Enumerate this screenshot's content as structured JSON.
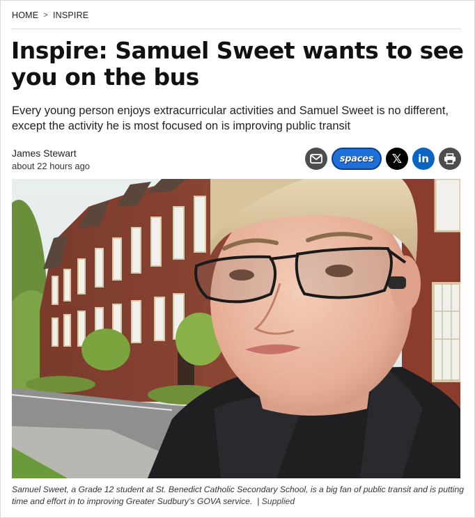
{
  "breadcrumb": {
    "home": "HOME",
    "separator": ">",
    "section": "INSPIRE"
  },
  "article": {
    "headline": "Inspire: Samuel Sweet wants to see you on the bus",
    "dek": "Every young person enjoys extracurricular activities and Samuel Sweet is no different, except the activity he is most focused on is improving public transit",
    "author": "James Stewart",
    "timestamp": "about 22 hours ago"
  },
  "share": {
    "email_icon": "envelope-icon",
    "spaces_label": "spaces",
    "x_label": "𝕏",
    "linkedin_label": "in",
    "print_icon": "printer-icon"
  },
  "photo": {
    "caption": "Samuel Sweet, a Grade 12 student at St. Benedict Catholic Secondary School, is a big fan of public transit and is putting time and effort in to improving Greater Sudbury's GOVA service.",
    "credit_separator": "|",
    "credit": "Supplied"
  },
  "colors": {
    "linkedin": "#0a66c2",
    "spaces": "#1e6fd9",
    "icon_dark": "#4d4d4d"
  }
}
